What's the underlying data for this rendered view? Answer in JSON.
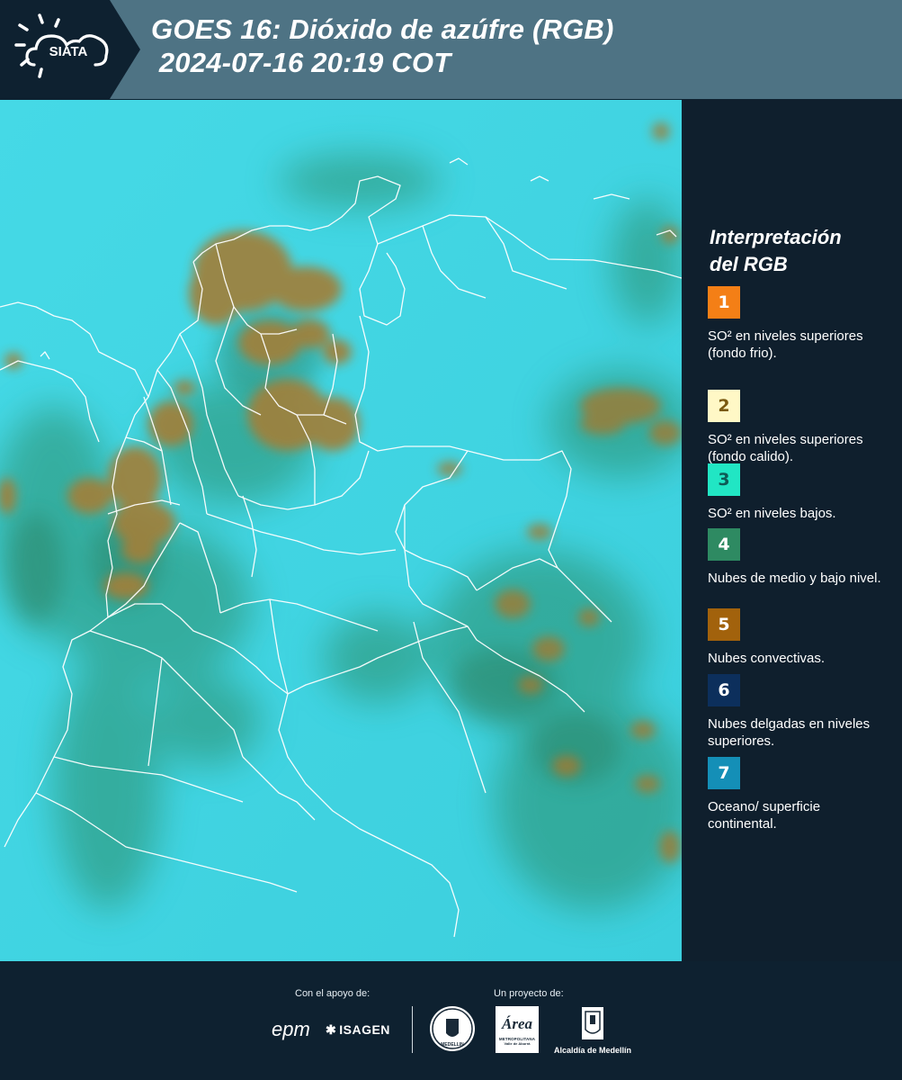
{
  "header": {
    "logo_text": "SIATA",
    "title_line1": "GOES 16: Dióxido de azúfre (RGB)",
    "title_line2": " 2024-07-16 20:19 COT",
    "colors": {
      "background": "#4e7384",
      "logo_panel": "#0e2130"
    }
  },
  "legend": {
    "title_line1": "Interpretación",
    "title_line2": "del RGB",
    "items": [
      {
        "number": "1",
        "color": "#f47f16",
        "number_color": "#ffffff",
        "label": "SO² en niveles superiores (fondo frio)."
      },
      {
        "number": "2",
        "color": "#fff8c6",
        "number_color": "#7a5a10",
        "label": "SO² en niveles superiores (fondo calido)."
      },
      {
        "number": "3",
        "color": "#21e6c4",
        "number_color": "#0e5a55",
        "label": "SO² en niveles bajos."
      },
      {
        "number": "4",
        "color": "#2e8a62",
        "number_color": "#ffffff",
        "label": "Nubes de medio y bajo nivel."
      },
      {
        "number": "5",
        "color": "#a2620c",
        "number_color": "#ffffff",
        "label": "Nubes convectivas."
      },
      {
        "number": "6",
        "color": "#0c2f5c",
        "number_color": "#ffffff",
        "label": "Nubes delgadas en niveles superiores."
      },
      {
        "number": "7",
        "color": "#148fb7",
        "number_color": "#ffffff",
        "label": "Oceano/ superficie continental."
      }
    ]
  },
  "footer": {
    "support_caption": "Con el apoyo de:",
    "project_caption": "Un proyecto de:",
    "partners": {
      "epm": "epm",
      "isagen": "ISAGEN",
      "area_metro": "Área",
      "area_metro_sub": "METROPOLITANA",
      "area_metro_sub2": "Valle de Aburrá",
      "medellin_seal_text": "MEDELLIN",
      "alcaldia": "Alcaldía de Medellín"
    }
  },
  "map": {
    "colors": {
      "ocean_surface": "#3ed4e0",
      "mid_low_clouds": "#2e8a62",
      "convective_clouds": "#a07a30",
      "borders": "#ffffff"
    }
  }
}
